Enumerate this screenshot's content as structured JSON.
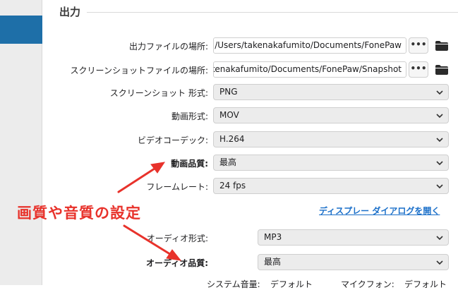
{
  "section": {
    "title": "出力"
  },
  "output_location": {
    "label": "出力ファイルの場所:",
    "value": "/Users/takenakafumito/Documents/FonePaw",
    "browse_label": "•••"
  },
  "screenshot_location": {
    "label": "スクリーンショットファイルの場所:",
    "value": "/Users/takenakafumito/Documents/FonePaw/Snapshot",
    "browse_label": "•••"
  },
  "screenshot_format": {
    "label": "スクリーンショット 形式:",
    "value": "PNG"
  },
  "video_format": {
    "label": "動画形式:",
    "value": "MOV"
  },
  "video_codec": {
    "label": "ビデオコーデック:",
    "value": "H.264"
  },
  "video_quality": {
    "label": "動画品質:",
    "value": "最高"
  },
  "frame_rate": {
    "label": "フレームレート:",
    "value": "24 fps"
  },
  "display_dialog_link": "ディスプレー ダイアログを開く",
  "audio_format": {
    "label": "オーディオ形式:",
    "value": "MP3"
  },
  "audio_quality": {
    "label": "オーディオ品質:",
    "value": "最高"
  },
  "system_audio": {
    "label": "システム音量:",
    "value": "デフォルト"
  },
  "microphone": {
    "label": "マイクフォン:",
    "value": "デフォルト"
  },
  "annotation": {
    "text": "画質や音質の設定",
    "color": "#e8322b"
  },
  "colors": {
    "accent": "#1e6fa8",
    "link": "#1a6fc9"
  }
}
